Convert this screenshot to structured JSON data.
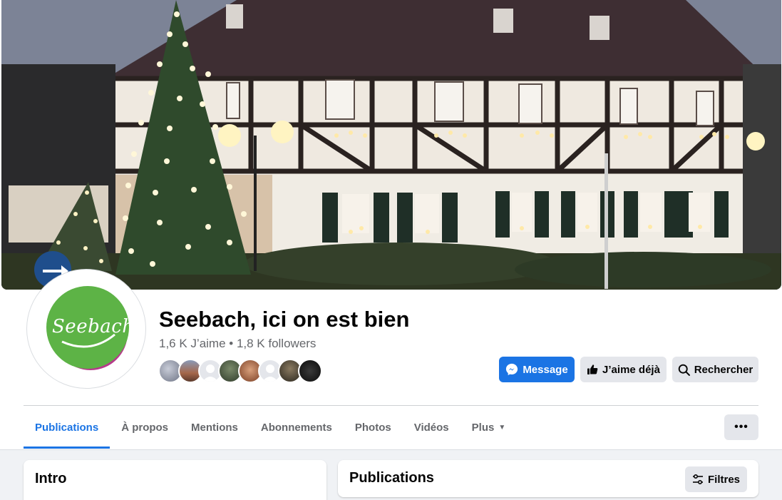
{
  "page": {
    "title": "Seebach, ici on est bien",
    "stats": "1,6 K J’aime • 1,8 K followers",
    "logo_text": "Seebach"
  },
  "actions": {
    "message": "Message",
    "like": "J’aime déjà",
    "search": "Rechercher"
  },
  "tabs": [
    {
      "label": "Publications"
    },
    {
      "label": "À propos"
    },
    {
      "label": "Mentions"
    },
    {
      "label": "Abonnements"
    },
    {
      "label": "Photos"
    },
    {
      "label": "Vidéos"
    },
    {
      "label": "Plus"
    }
  ],
  "more_label": "•••",
  "sections": {
    "intro_title": "Intro",
    "posts_title": "Publications",
    "filters": "Filtres"
  },
  "colors": {
    "accent": "#1b74e4",
    "secondary_button": "#e4e6eb",
    "muted_text": "#65676b",
    "logo_green": "#5db346"
  },
  "icons": {
    "messenger": "messenger-icon",
    "like": "thumbs-up-icon",
    "search": "search-icon",
    "filters": "sliders-icon",
    "dropdown": "caret-down-icon",
    "more": "more-dots-icon"
  }
}
